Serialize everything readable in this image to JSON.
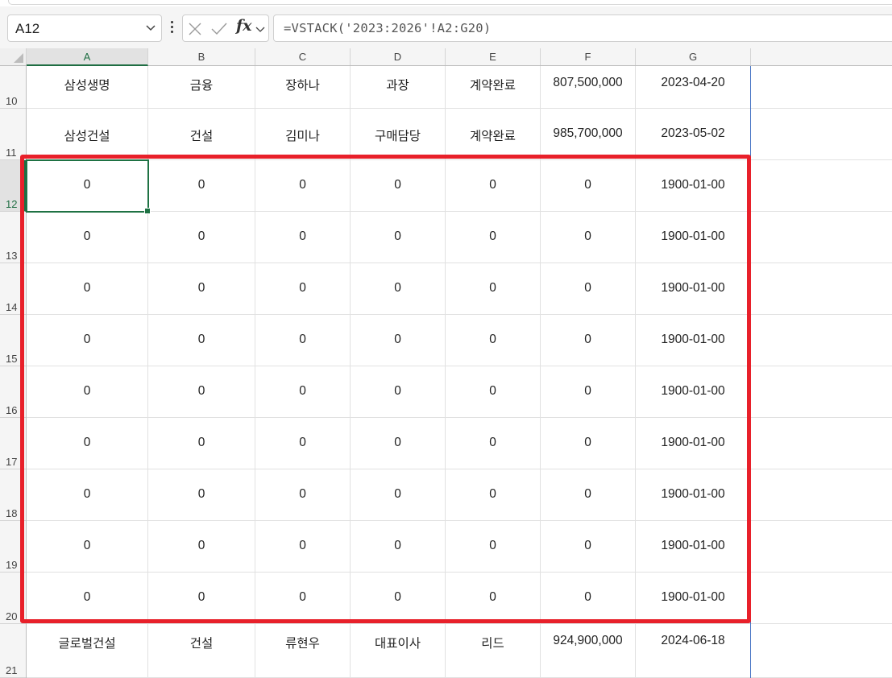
{
  "formula_bar": {
    "name_box": "A12",
    "formula": "=VSTACK('2023:2026'!A2:G20)",
    "cancel_icon": "x-icon",
    "enter_icon": "check-icon",
    "function_icon": "fx-icon",
    "fx_symbol": "fx"
  },
  "columns": [
    "A",
    "B",
    "C",
    "D",
    "E",
    "F",
    "G"
  ],
  "selected_cell": "A12",
  "highlight_color": "#e8202a",
  "rows": [
    {
      "num": "10",
      "cells": [
        "삼성생명",
        "금융",
        "장하나",
        "과장",
        "계약완료",
        "807,500,000",
        "2023-04-20"
      ]
    },
    {
      "num": "11",
      "cells": [
        "삼성건설",
        "건설",
        "김미나",
        "구매담당",
        "계약완료",
        "985,700,000",
        "2023-05-02"
      ]
    },
    {
      "num": "12",
      "cells": [
        "0",
        "0",
        "0",
        "0",
        "0",
        "0",
        "1900-01-00"
      ]
    },
    {
      "num": "13",
      "cells": [
        "0",
        "0",
        "0",
        "0",
        "0",
        "0",
        "1900-01-00"
      ]
    },
    {
      "num": "14",
      "cells": [
        "0",
        "0",
        "0",
        "0",
        "0",
        "0",
        "1900-01-00"
      ]
    },
    {
      "num": "15",
      "cells": [
        "0",
        "0",
        "0",
        "0",
        "0",
        "0",
        "1900-01-00"
      ]
    },
    {
      "num": "16",
      "cells": [
        "0",
        "0",
        "0",
        "0",
        "0",
        "0",
        "1900-01-00"
      ]
    },
    {
      "num": "17",
      "cells": [
        "0",
        "0",
        "0",
        "0",
        "0",
        "0",
        "1900-01-00"
      ]
    },
    {
      "num": "18",
      "cells": [
        "0",
        "0",
        "0",
        "0",
        "0",
        "0",
        "1900-01-00"
      ]
    },
    {
      "num": "19",
      "cells": [
        "0",
        "0",
        "0",
        "0",
        "0",
        "0",
        "1900-01-00"
      ]
    },
    {
      "num": "20",
      "cells": [
        "0",
        "0",
        "0",
        "0",
        "0",
        "0",
        "1900-01-00"
      ]
    },
    {
      "num": "21",
      "cells": [
        "글로벌건설",
        "건설",
        "류현우",
        "대표이사",
        "리드",
        "924,900,000",
        "2024-06-18"
      ]
    }
  ]
}
